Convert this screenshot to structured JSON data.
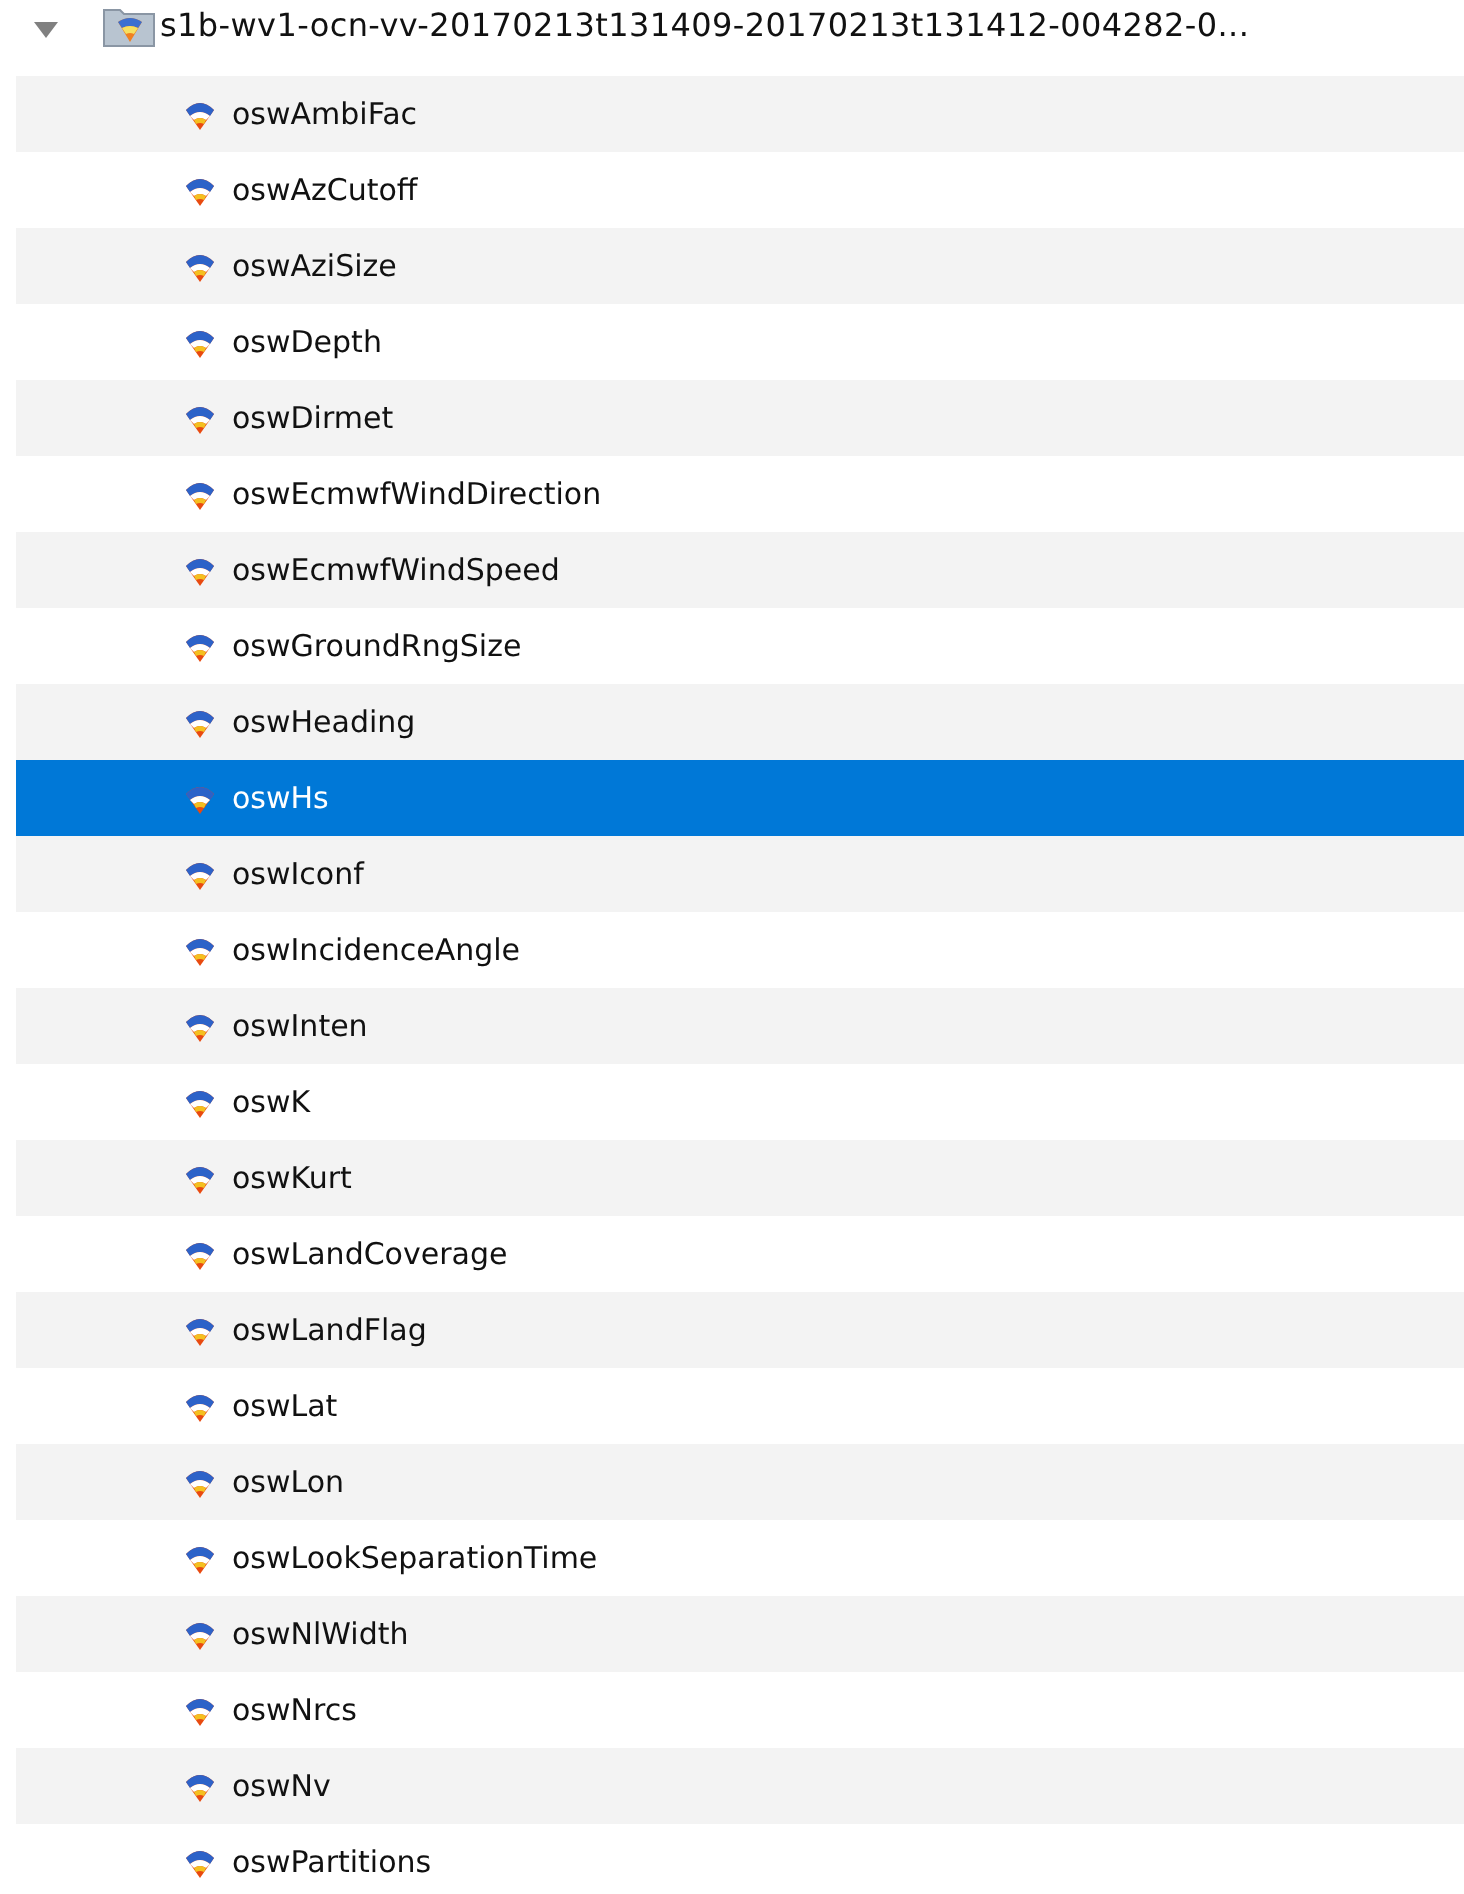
{
  "tree": {
    "label": "s1b-wv1-ocn-vv-20170213t131409-20170213t131412-004282-0...",
    "expanded": true,
    "children": [
      {
        "label": "oswAmbiFac",
        "selected": false
      },
      {
        "label": "oswAzCutoff",
        "selected": false
      },
      {
        "label": "oswAziSize",
        "selected": false
      },
      {
        "label": "oswDepth",
        "selected": false
      },
      {
        "label": "oswDirmet",
        "selected": false
      },
      {
        "label": "oswEcmwfWindDirection",
        "selected": false
      },
      {
        "label": "oswEcmwfWindSpeed",
        "selected": false
      },
      {
        "label": "oswGroundRngSize",
        "selected": false
      },
      {
        "label": "oswHeading",
        "selected": false
      },
      {
        "label": "oswHs",
        "selected": true
      },
      {
        "label": "oswIconf",
        "selected": false
      },
      {
        "label": "oswIncidenceAngle",
        "selected": false
      },
      {
        "label": "oswInten",
        "selected": false
      },
      {
        "label": "oswK",
        "selected": false
      },
      {
        "label": "oswKurt",
        "selected": false
      },
      {
        "label": "oswLandCoverage",
        "selected": false
      },
      {
        "label": "oswLandFlag",
        "selected": false
      },
      {
        "label": "oswLat",
        "selected": false
      },
      {
        "label": "oswLon",
        "selected": false
      },
      {
        "label": "oswLookSeparationTime",
        "selected": false
      },
      {
        "label": "oswNlWidth",
        "selected": false
      },
      {
        "label": "oswNrcs",
        "selected": false
      },
      {
        "label": "oswNv",
        "selected": false
      },
      {
        "label": "oswPartitions",
        "selected": false
      }
    ]
  }
}
